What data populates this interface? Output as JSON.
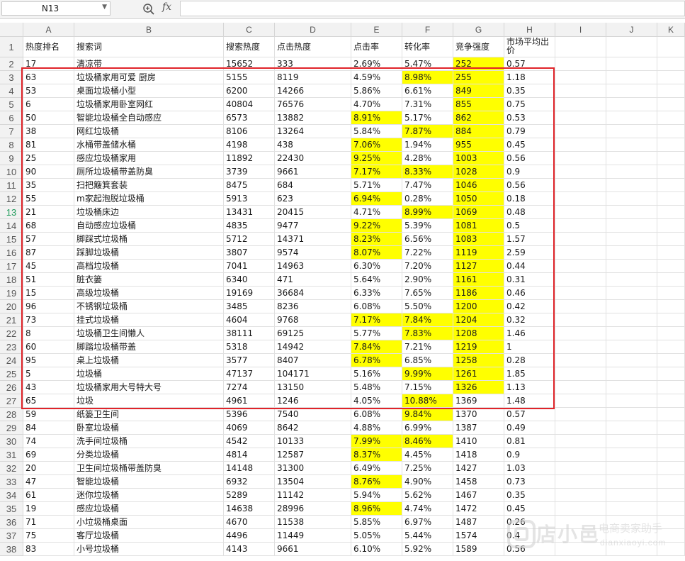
{
  "formula_bar": {
    "name_box": "N13",
    "fx_label": "fx",
    "formula": ""
  },
  "columns": [
    "A",
    "B",
    "C",
    "D",
    "E",
    "F",
    "G",
    "H",
    "I",
    "J",
    "K"
  ],
  "active_row": 13,
  "headers": [
    "热度排名",
    "搜索词",
    "搜索热度",
    "点击热度",
    "点击率",
    "转化率",
    "竞争强度",
    "市场平均出价"
  ],
  "rows": [
    [
      "17",
      "清凉带",
      "15652",
      "333",
      "2.69%",
      "5.47%",
      "252",
      "0.57"
    ],
    [
      "63",
      "垃圾桶家用可爱 厨房",
      "5155",
      "8119",
      "4.59%",
      "8.98%",
      "255",
      "1.18"
    ],
    [
      "53",
      "桌面垃圾桶小型",
      "6200",
      "14266",
      "5.86%",
      "6.61%",
      "849",
      "0.35"
    ],
    [
      "6",
      "垃圾桶家用卧室网红",
      "40804",
      "76576",
      "4.70%",
      "7.31%",
      "855",
      "0.75"
    ],
    [
      "50",
      "智能垃圾桶全自动感应",
      "6573",
      "13882",
      "8.91%",
      "5.17%",
      "862",
      "0.53"
    ],
    [
      "38",
      "网红垃圾桶",
      "8106",
      "13264",
      "5.84%",
      "7.87%",
      "884",
      "0.79"
    ],
    [
      "81",
      "水桶带盖储水桶",
      "4198",
      "438",
      "7.06%",
      "1.94%",
      "955",
      "0.45"
    ],
    [
      "25",
      "感应垃圾桶家用",
      "11892",
      "22430",
      "9.25%",
      "4.28%",
      "1003",
      "0.56"
    ],
    [
      "90",
      "厕所垃圾桶带盖防臭",
      "3739",
      "9661",
      "7.17%",
      "8.33%",
      "1028",
      "0.9"
    ],
    [
      "35",
      "扫把簸箕套装",
      "8475",
      "684",
      "5.71%",
      "7.47%",
      "1046",
      "0.56"
    ],
    [
      "55",
      "m家起泡脱垃圾桶",
      "5913",
      "623",
      "6.94%",
      "0.28%",
      "1050",
      "0.18"
    ],
    [
      "21",
      "垃圾桶床边",
      "13431",
      "20415",
      "4.71%",
      "8.99%",
      "1069",
      "0.48"
    ],
    [
      "68",
      "自动感应垃圾桶",
      "4835",
      "9477",
      "9.22%",
      "5.39%",
      "1081",
      "0.5"
    ],
    [
      "57",
      "脚踩式垃圾桶",
      "5712",
      "14371",
      "8.23%",
      "6.56%",
      "1083",
      "1.57"
    ],
    [
      "87",
      "踩脚垃圾桶",
      "3807",
      "9574",
      "8.07%",
      "7.22%",
      "1119",
      "2.59"
    ],
    [
      "45",
      "高档垃圾桶",
      "7041",
      "14963",
      "6.30%",
      "7.20%",
      "1127",
      "0.44"
    ],
    [
      "51",
      "脏衣篓",
      "6340",
      "471",
      "5.64%",
      "2.90%",
      "1161",
      "0.31"
    ],
    [
      "15",
      "高级垃圾桶",
      "19169",
      "36684",
      "6.33%",
      "7.65%",
      "1186",
      "0.46"
    ],
    [
      "96",
      "不锈钢垃圾桶",
      "3485",
      "8236",
      "6.08%",
      "5.50%",
      "1200",
      "0.42"
    ],
    [
      "73",
      "挂式垃圾桶",
      "4604",
      "9768",
      "7.17%",
      "7.84%",
      "1204",
      "0.32"
    ],
    [
      "8",
      "垃圾桶卫生间懒人",
      "38111",
      "69125",
      "5.77%",
      "7.83%",
      "1208",
      "1.46"
    ],
    [
      "60",
      "脚踏垃圾桶带盖",
      "5318",
      "14942",
      "7.84%",
      "7.21%",
      "1219",
      "1"
    ],
    [
      "95",
      "桌上垃圾桶",
      "3577",
      "8407",
      "6.78%",
      "6.85%",
      "1258",
      "0.28"
    ],
    [
      "5",
      "垃圾桶",
      "47137",
      "104171",
      "5.16%",
      "9.99%",
      "1261",
      "1.85"
    ],
    [
      "43",
      "垃圾桶家用大号特大号",
      "7274",
      "13150",
      "5.48%",
      "7.15%",
      "1326",
      "1.13"
    ],
    [
      "65",
      "垃圾",
      "4961",
      "1246",
      "4.05%",
      "10.88%",
      "1369",
      "1.48"
    ],
    [
      "59",
      "纸篓卫生间",
      "5396",
      "7540",
      "6.08%",
      "9.84%",
      "1370",
      "0.57"
    ],
    [
      "84",
      "卧室垃圾桶",
      "4069",
      "8642",
      "4.88%",
      "6.99%",
      "1387",
      "0.49"
    ],
    [
      "74",
      "洗手间垃圾桶",
      "4542",
      "10133",
      "7.99%",
      "8.46%",
      "1410",
      "0.81"
    ],
    [
      "69",
      "分类垃圾桶",
      "4814",
      "12587",
      "8.37%",
      "4.45%",
      "1418",
      "0.9"
    ],
    [
      "20",
      "卫生间垃圾桶带盖防臭",
      "14148",
      "31300",
      "6.49%",
      "7.25%",
      "1427",
      "1.03"
    ],
    [
      "47",
      "智能垃圾桶",
      "6932",
      "13504",
      "8.76%",
      "4.90%",
      "1458",
      "0.73"
    ],
    [
      "61",
      "迷你垃圾桶",
      "5289",
      "11142",
      "5.94%",
      "5.62%",
      "1467",
      "0.35"
    ],
    [
      "19",
      "感应垃圾桶",
      "14638",
      "28996",
      "8.96%",
      "4.74%",
      "1472",
      "0.45"
    ],
    [
      "71",
      "小垃圾桶桌面",
      "4670",
      "11538",
      "5.85%",
      "6.97%",
      "1487",
      "0.26"
    ],
    [
      "75",
      "客厅垃圾桶",
      "4496",
      "11449",
      "5.05%",
      "5.44%",
      "1574",
      "0.4"
    ],
    [
      "83",
      "小号垃圾桶",
      "4143",
      "9661",
      "6.10%",
      "5.92%",
      "1589",
      "0.56"
    ]
  ],
  "highlight_color": "#ffff00",
  "selection_color": "#e0242a",
  "watermark": {
    "brand": "店小邑",
    "subtitle": "电商卖家助手",
    "url": "dianxiaoyi.com"
  }
}
